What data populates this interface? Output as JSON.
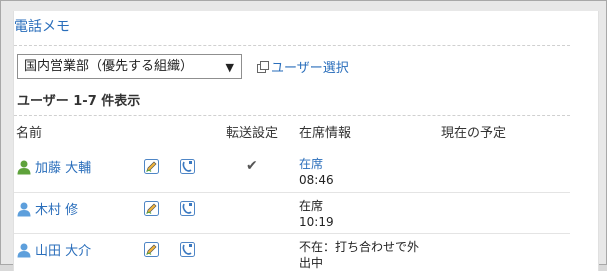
{
  "header": {
    "title": "電話メモ"
  },
  "group_select": {
    "value": "国内営業部（優先する組織）",
    "arrow": "▼"
  },
  "user_picker": {
    "label": "ユーザー選択"
  },
  "result_count": "ユーザー 1-7 件表示",
  "table": {
    "columns": {
      "name": "名前",
      "forward": "転送設定",
      "presence": "在席情報",
      "schedule": "現在の予定"
    },
    "rows": [
      {
        "name": "加藤 大輔",
        "icon": "user-icon-green",
        "forward": "✔",
        "status_line1": "在席",
        "status_line2": "08:46",
        "status_is_link": true
      },
      {
        "name": "木村 修",
        "icon": "user-icon-blue",
        "forward": "",
        "status_line1": "在席",
        "status_line2": "10:19",
        "status_is_link": false
      },
      {
        "name": "山田 大介",
        "icon": "user-icon-blue",
        "forward": "",
        "status_line1": "不在：打ち合わせで外",
        "status_line2": "出中",
        "status_is_link": false
      }
    ]
  },
  "colors": {
    "link": "#2a6ebb",
    "user_green": "#5ea23b",
    "user_blue": "#5d9fdc"
  }
}
